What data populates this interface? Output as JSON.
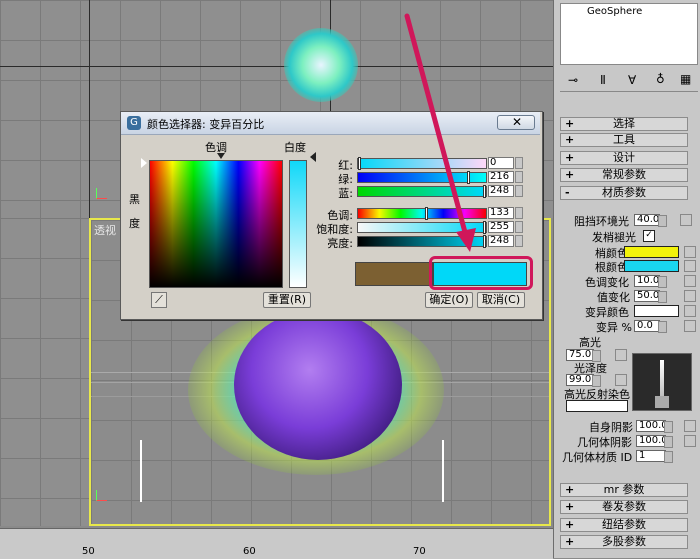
{
  "viewport": {
    "perspective_label": "透视",
    "ruler_ticks": [
      "50",
      "60",
      "70"
    ]
  },
  "panel": {
    "object_name": "GeoSphere",
    "rollouts_top": [
      {
        "sign": "+",
        "label": "选择"
      },
      {
        "sign": "+",
        "label": "工具"
      },
      {
        "sign": "+",
        "label": "设计"
      },
      {
        "sign": "+",
        "label": "常规参数"
      },
      {
        "sign": "-",
        "label": "材质参数"
      }
    ],
    "params": {
      "ambient_label": "阻挡环境光",
      "ambient_value": "40.0",
      "self_illum_label": "发梢褪光",
      "self_illum_check": "✓",
      "tip_color_label": "梢颜色",
      "root_color_label": "根颜色",
      "hue_var_label": "色调变化",
      "hue_var_value": "10.0",
      "value_var_label": "值变化",
      "value_var_value": "50.0",
      "mutant_color_label": "变异颜色",
      "mutant_pct_label": "变异 %",
      "mutant_pct_value": "0.0",
      "highlight_label": "高光",
      "highlight_value": "75.0",
      "gloss_label": "光泽度",
      "gloss_value": "99.0",
      "spec_tint_label": "高光反射染色",
      "self_shadow_label": "自身阴影",
      "self_shadow_value": "100.0",
      "geo_shadow_label": "几何体阴影",
      "geo_shadow_value": "100.0",
      "geo_material_label": "几何体材质 ID",
      "geo_material_value": "1"
    },
    "rollouts_bottom": [
      {
        "sign": "+",
        "label": "mr 参数"
      },
      {
        "sign": "+",
        "label": "卷发参数"
      },
      {
        "sign": "+",
        "label": "纽结参数"
      },
      {
        "sign": "+",
        "label": "多股参数"
      }
    ]
  },
  "dialog": {
    "title": "颜色选择器: 变异百分比",
    "hue_header": "色调",
    "white_label": "白度",
    "black_label": "黑\n度",
    "reset_label": "重置(R)",
    "ok_label": "确定(O)",
    "cancel_label": "取消(C)",
    "sliders": [
      {
        "label": "红:",
        "value": "0"
      },
      {
        "label": "绿:",
        "value": "216"
      },
      {
        "label": "蓝:",
        "value": "248"
      },
      {
        "label": "色调:",
        "value": "133"
      },
      {
        "label": "饱和度:",
        "value": "255"
      },
      {
        "label": "亮度:",
        "value": "248"
      }
    ],
    "old_color": "#7c6032",
    "new_color": "#00d8f8"
  },
  "annotation": {
    "arrow_color": "#d0175a",
    "highlight_color": "#d0175a"
  },
  "colors": {
    "tip_color": "#f2f20a",
    "root_color": "#19d5f0",
    "mutant_color": "#ffffff"
  }
}
